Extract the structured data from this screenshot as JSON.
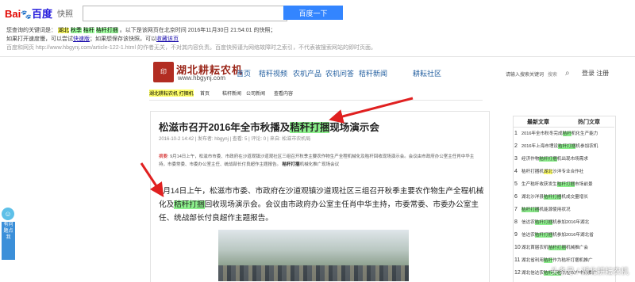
{
  "baidu": {
    "logo_left": "Bai",
    "logo_paw": "🐾",
    "logo_right": "百度",
    "kuaizhao": "快照",
    "search_value": "",
    "search_button": "百度一下",
    "cache_line1_prefix": "您查询的关键词是：",
    "cache_kw1": "湖北",
    "cache_kw2": "秋季",
    "cache_kw3": "秸秆",
    "cache_kw4": "秸秆打捆",
    "cache_line1_suffix": "。以下是该网页在北京时间 2016年11月30日 21:54:01 的快照；",
    "cache_line2_prefix": "如果打开速度慢，可以尝试",
    "cache_line2_link1": "快速版",
    "cache_line2_mid": "；如果想保存该快照，可以",
    "cache_line2_link2": "收藏该页",
    "cache_line3": "百度和网页 http://www.hbgynj.com/article-122-1.html 的作者无关，不对其内容负责。百度快照谨为网络故障时之索引，不代表被搜索网站的即时页面。"
  },
  "site": {
    "seal": "印",
    "name": "湖北耕耘农机",
    "url": "www.hbgynj.com",
    "nav": [
      "首页",
      "秸秆视频",
      "农机产品",
      "农机问答",
      "秸秆新闻",
      "耕耘社区"
    ],
    "user_login": "请输入搜索关键词",
    "search_hint": "搜索",
    "login": "登录",
    "register": "注册",
    "subnav": [
      "湖北耕耘农机 打捆机",
      "首页",
      "秸秆新闻",
      "公司新闻",
      "查看内容"
    ]
  },
  "article": {
    "title_pre": "松滋市召开2016年全市秋播及",
    "title_hl": "秸秆打捆",
    "title_post": "现场演示会",
    "meta": "2016-10-2 14:42  |  发布者: hbgynj  |  查看: 5  |  评论: 0  |  来自: 松滋市农机局",
    "summary_label": "摘要",
    "summary_text": ": 9月14日上午，松滋市市委、市政府在沙道观镇沙道观社区三组召开秋季主要农作物生产全程机械化及秸秆回收现场演示会。会议由市政府办公室主任肖中华主持，市委常委、市委办公室主任、统战部长付良超作主题报告。",
    "summary_bold": "秸秆打捆",
    "summary_tail": "机械化推广现场会议",
    "body_p1": "9月14日上午，松滋市市委、市政府在沙道观镇沙道观社区三组召开秋季主要农作物生产全程机械化及",
    "body_hl": "秸秆打捆",
    "body_p2": "回收现场演示会。会议由市政府办公室主任肖中华主持，市委常委、市委办公室主任、统战部长付良超作主题报告。"
  },
  "sidebar": {
    "tab_latest": "最新文章",
    "tab_hot": "热门文章",
    "items": [
      {
        "num": "1",
        "pre": "2016年全市秋冬完成",
        "hl": "秸秆",
        "post": "机化生产能力"
      },
      {
        "num": "2",
        "pre": "2016年上海市埋设",
        "hl": "秸秆打捆",
        "post": "机参加农机"
      },
      {
        "num": "3",
        "pre": "经济作物",
        "hl": "秸秆打捆",
        "post": "机出现市场需求"
      },
      {
        "num": "4",
        "pre": "秸秆打捆机",
        "hl": "湖北",
        "post": "沙洋专业合作社"
      },
      {
        "num": "5",
        "pre": "生产秸秆收获发生",
        "hl": "秸秆打捆",
        "post": "市场前景"
      },
      {
        "num": "6",
        "pre": "湖北沙洋县",
        "hl": "秸秆打捆",
        "post": "机成交量增长"
      },
      {
        "num": "7",
        "pre": "",
        "hl": "秸秆打捆",
        "post": "机能源使用状况"
      },
      {
        "num": "8",
        "pre": "信达农",
        "hl": "秸秆打捆",
        "post": "机参加2016年湖北"
      },
      {
        "num": "9",
        "pre": "信达农",
        "hl": "秸秆打捆",
        "post": "机参加2016年湖北省"
      },
      {
        "num": "10",
        "pre": "湖北首届农机",
        "hl": "秸秆打捆",
        "post": "机械推广会"
      },
      {
        "num": "11",
        "pre": "湖北省利用",
        "hl": "秸秆",
        "post": "作为秸秆打捆机推广"
      },
      {
        "num": "12",
        "pre": "湖北信达农",
        "hl": "秸秆打捆",
        "post": "机在农户中的推广"
      }
    ]
  },
  "widget": {
    "label": "有问题点我"
  },
  "watermark": "头条号 / 湖北耕耘农机",
  "colors": {
    "accent_blue": "#3385ff",
    "highlight_green": "#8cf08c",
    "highlight_yellow": "#ffff66",
    "arrow_red": "#e02020"
  }
}
